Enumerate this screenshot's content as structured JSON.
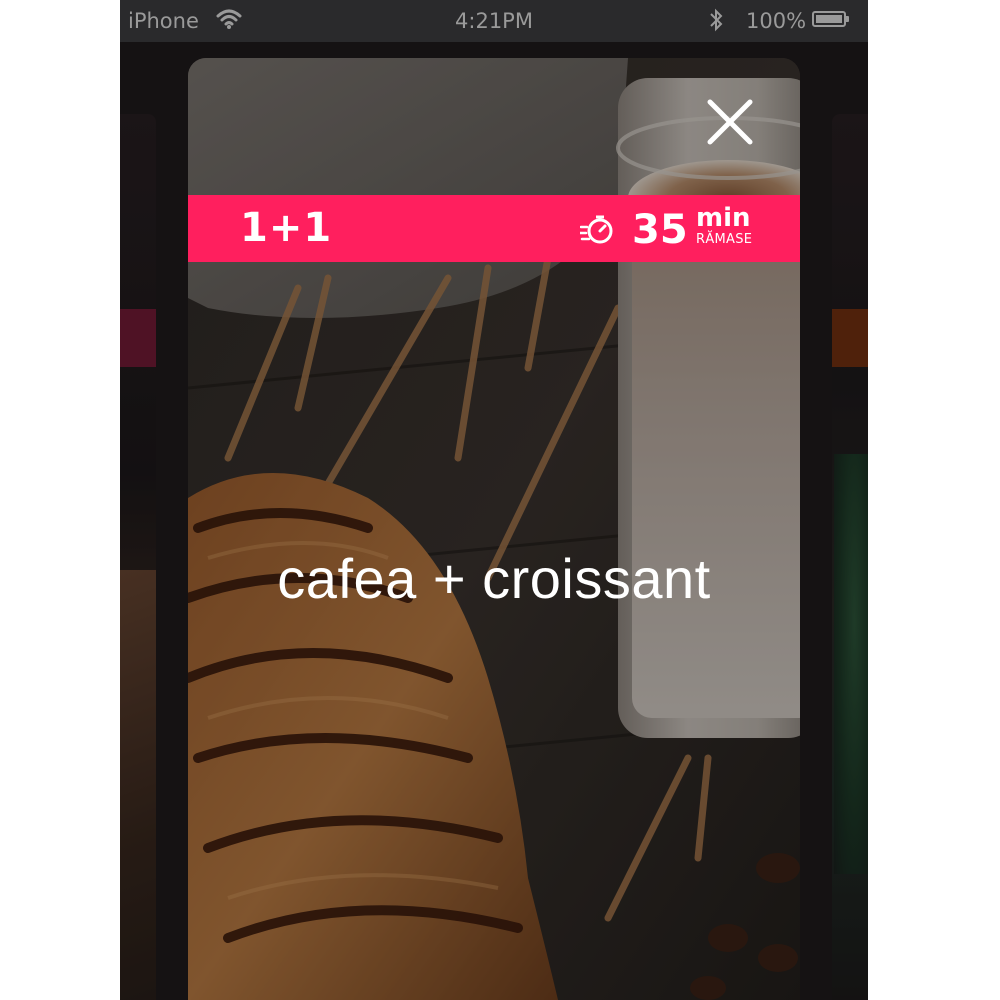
{
  "status_bar": {
    "carrier": "iPhone",
    "time": "4:21PM",
    "battery_percent": "100%"
  },
  "offer": {
    "promo_label": "1+1",
    "timer_value": "35",
    "timer_unit": "min",
    "timer_remaining_label": "RĂMASE",
    "title": "cafea + croissant"
  },
  "colors": {
    "banner": "#ff1f5e",
    "text": "#ffffff"
  },
  "icons": {
    "close": "close-icon",
    "timer": "stopwatch-icon",
    "wifi": "wifi-icon",
    "bluetooth": "bluetooth-icon",
    "battery": "battery-icon"
  }
}
